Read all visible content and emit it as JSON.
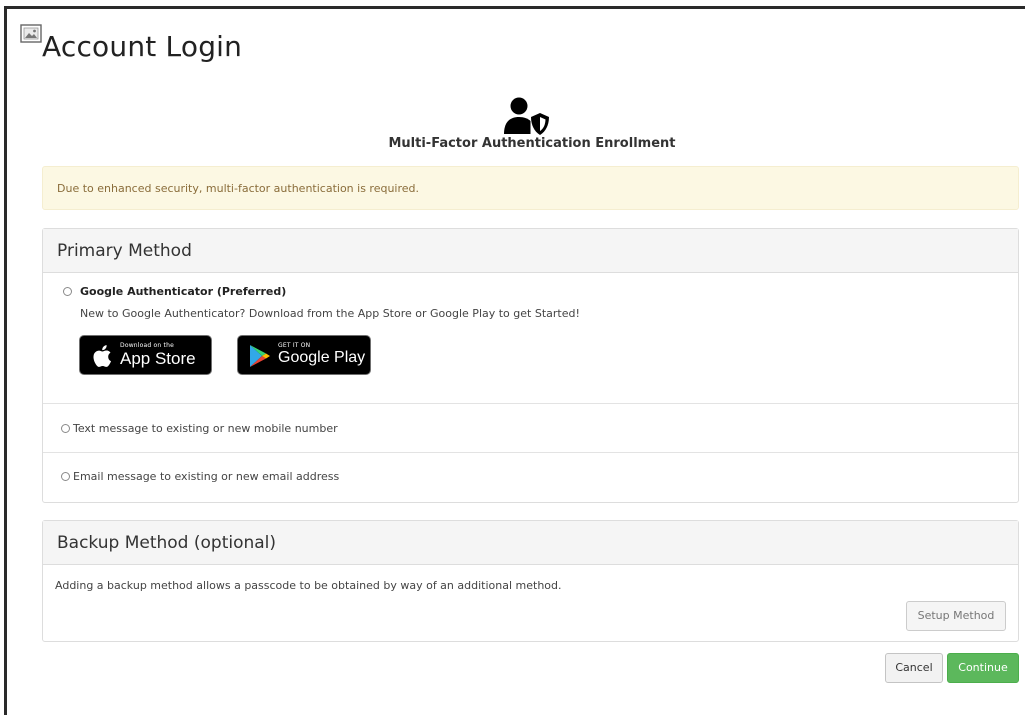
{
  "page": {
    "title": "Account Login",
    "broken_image_icon": "broken-image-icon"
  },
  "enrollment": {
    "icon": "user-shield-icon",
    "heading": "Multi-Factor Authentication Enrollment"
  },
  "alert": {
    "text": "Due to enhanced security, multi-factor authentication is required.",
    "background": "#fcf8e3",
    "color": "#8a6d3b"
  },
  "primary_method": {
    "heading": "Primary Method",
    "options": [
      {
        "label": "Google Authenticator (Preferred)",
        "description": "New to Google Authenticator? Download from the App Store or Google Play to get Started!",
        "selected": false
      },
      {
        "label": "Text message to existing or new mobile number",
        "selected": false
      },
      {
        "label": "Email message to existing or new email address",
        "selected": false
      }
    ],
    "badges": {
      "apple": {
        "small": "Download on the",
        "big": "App Store",
        "icon": "apple-icon"
      },
      "google": {
        "small": "GET IT ON",
        "big": "Google Play",
        "icon": "google-play-icon"
      }
    }
  },
  "backup_method": {
    "heading": "Backup Method (optional)",
    "text": "Adding a backup method allows a passcode to be obtained by way of an additional method.",
    "setup_button": "Setup Method"
  },
  "footer": {
    "cancel": "Cancel",
    "continue": "Continue",
    "continue_color": "#5cb85c"
  }
}
